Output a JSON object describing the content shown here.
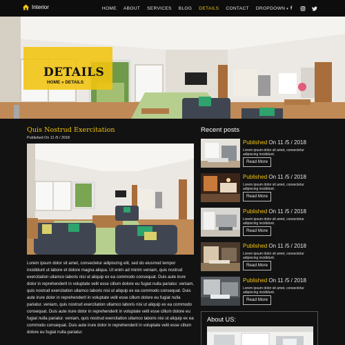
{
  "brand": {
    "name": "Interior"
  },
  "nav": {
    "items": [
      {
        "label": "HOME",
        "active": false
      },
      {
        "label": "ABOUT",
        "active": false
      },
      {
        "label": "SERVICES",
        "active": false
      },
      {
        "label": "BLOG",
        "active": false
      },
      {
        "label": "DETAILS",
        "active": true
      },
      {
        "label": "CONTACT",
        "active": false
      },
      {
        "label": "DROPDOWN",
        "active": false
      }
    ],
    "social": [
      "f",
      "instagram-icon",
      "twitter-icon"
    ]
  },
  "hero": {
    "title": "DETAILS",
    "breadcrumb": {
      "home": "HOME",
      "sep": "»",
      "current": "DETAILS"
    }
  },
  "post": {
    "title": "Quis Nostrud Exercitation",
    "meta": "Published On 11 /5 / 2018",
    "body": "Lorem ipsum dolor sit amet, consectetur adipiscing elit, sed do eiusmod tempor incididunt ut labore et dolore magna aliqua. Ut enim ad minim veniam, quis nostrud exercitation ullamco laboris nisi ut aliquip ex ea commodo consequat. Duis aute irure dolor in reprehenderit in voluptate velit esse cillum dolore eu fugiat nulla pariatur. veniam, quis nostrud exercitation ullamco laboris nisi ut aliquip ex ea commodo consequat. Duis aute irure dolor in reprehenderit in voluptate velit esse cillum dolore eu fugiat nulla pariatur. veniam, quis nostrud exercitation ullamco laboris nisi ut aliquip ex ea commodo consequat. Duis aute irure dolor in reprehenderit in voluptate velit esse cillum dolore eu fugiat nulla pariatur. veniam, quis nostrud exercitation ullamco laboris nisi ut aliquip ex ea commodo consequat. Duis aute irure dolor in reprehenderit in voluptate velit esse cillum dolore eu fugiat nulla pariatur."
  },
  "sidebar": {
    "recent_title": "Recent posts",
    "recent": [
      {
        "published": "Published",
        "date": " On 11 /5 / 2018",
        "text": "Lorem ipsum dolor sit amet, consectetur adipiscing incididunt.",
        "button": "Read More"
      },
      {
        "published": "Published",
        "date": " On 11 /5 / 2018",
        "text": "Lorem ipsum dolor sit amet, consectetur adipiscing incididunt.",
        "button": "Read More"
      },
      {
        "published": "Published",
        "date": " On 11 /5 / 2018",
        "text": "Lorem ipsum dolor sit amet, consectetur adipiscing incididunt.",
        "button": "Read More"
      },
      {
        "published": "Published",
        "date": " On 11 /5 / 2018",
        "text": "Lorem ipsum dolor sit amet, consectetur adipiscing incididunt.",
        "button": "Read More"
      },
      {
        "published": "Published",
        "date": " On 11 /5 / 2018",
        "text": "Lorem ipsum dolor sit amet, consectetur adipiscing incididunt.",
        "button": "Read More"
      }
    ],
    "about_title": "About US:"
  },
  "colors": {
    "accent": "#f1c40f",
    "background": "#121212",
    "nav": "#0d0d0d"
  }
}
